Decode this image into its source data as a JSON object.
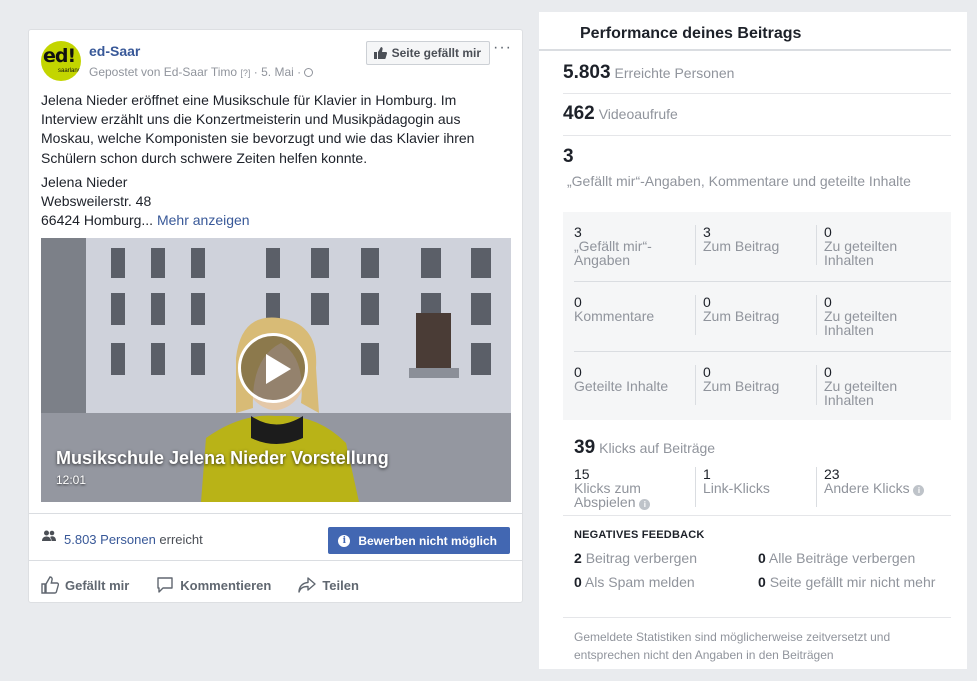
{
  "post": {
    "page_name": "ed-Saar",
    "avatar_text": "ed!",
    "avatar_sub": "saarland",
    "posted_by": "Gepostet von Ed-Saar Timo",
    "help_mark": "[?]",
    "date": "· 5. Mai ·",
    "like_page_label": "Seite gefällt mir",
    "more_label": "···",
    "body": "Jelena Nieder eröffnet eine Musikschule für Klavier in Homburg. Im Interview erzählt uns die Konzertmeisterin und Musikpädagogin aus Moskau, welche Komponisten sie bevorzugt und wie das Klavier ihren Schülern schon durch schwere Zeiten helfen konnte.",
    "address_line1": "Jelena Nieder",
    "address_line2": "Websweilerstr. 48",
    "address_line3": "66424 Homburg...",
    "see_more": "Mehr anzeigen",
    "video_title": "Musikschule Jelena Nieder Vorstellung",
    "video_duration": "12:01",
    "reach_count": "5.803 Personen",
    "reach_suffix": "erreicht",
    "boost_label": "Bewerben nicht möglich",
    "actions": {
      "like": "Gefällt mir",
      "comment": "Kommentieren",
      "share": "Teilen"
    }
  },
  "performance": {
    "title": "Performance deines Beitrags",
    "reached": {
      "value": "5.803",
      "label": "Erreichte Personen"
    },
    "views": {
      "value": "462",
      "label": "Videoaufrufe"
    },
    "engagement": {
      "value": "3",
      "label": "„Gefällt mir“-Angaben, Kommentare und geteilte Inhalte"
    },
    "grid": [
      [
        {
          "n": "3",
          "t": "„Gefällt mir“-Angaben"
        },
        {
          "n": "3",
          "t": "Zum Beitrag"
        },
        {
          "n": "0",
          "t": "Zu geteilten Inhalten"
        }
      ],
      [
        {
          "n": "0",
          "t": "Kommentare"
        },
        {
          "n": "0",
          "t": "Zum Beitrag"
        },
        {
          "n": "0",
          "t": "Zu geteilten Inhalten"
        }
      ],
      [
        {
          "n": "0",
          "t": "Geteilte Inhalte"
        },
        {
          "n": "0",
          "t": "Zum Beitrag"
        },
        {
          "n": "0",
          "t": "Zu geteilten Inhalten"
        }
      ]
    ],
    "clicks": {
      "value": "39",
      "label": "Klicks auf Beiträge",
      "play": {
        "n": "15",
        "t": "Klicks zum Abspielen"
      },
      "link": {
        "n": "1",
        "t": "Link-Klicks"
      },
      "other": {
        "n": "23",
        "t": "Andere Klicks"
      }
    },
    "negative": {
      "heading": "NEGATIVES FEEDBACK",
      "hide_post": {
        "n": "2",
        "t": "Beitrag verbergen"
      },
      "hide_all": {
        "n": "0",
        "t": "Alle Beiträge verbergen"
      },
      "spam": {
        "n": "0",
        "t": "Als Spam melden"
      },
      "unlike": {
        "n": "0",
        "t": "Seite gefällt mir nicht mehr"
      }
    },
    "footnote": "Gemeldete Statistiken sind möglicherweise zeitversetzt und entsprechen nicht den Angaben in den Beiträgen",
    "help_glyph": "i"
  },
  "colors": {
    "link": "#385898",
    "boost": "#4267b2",
    "avatar": "#c3d500",
    "background": "#e9ebee"
  }
}
